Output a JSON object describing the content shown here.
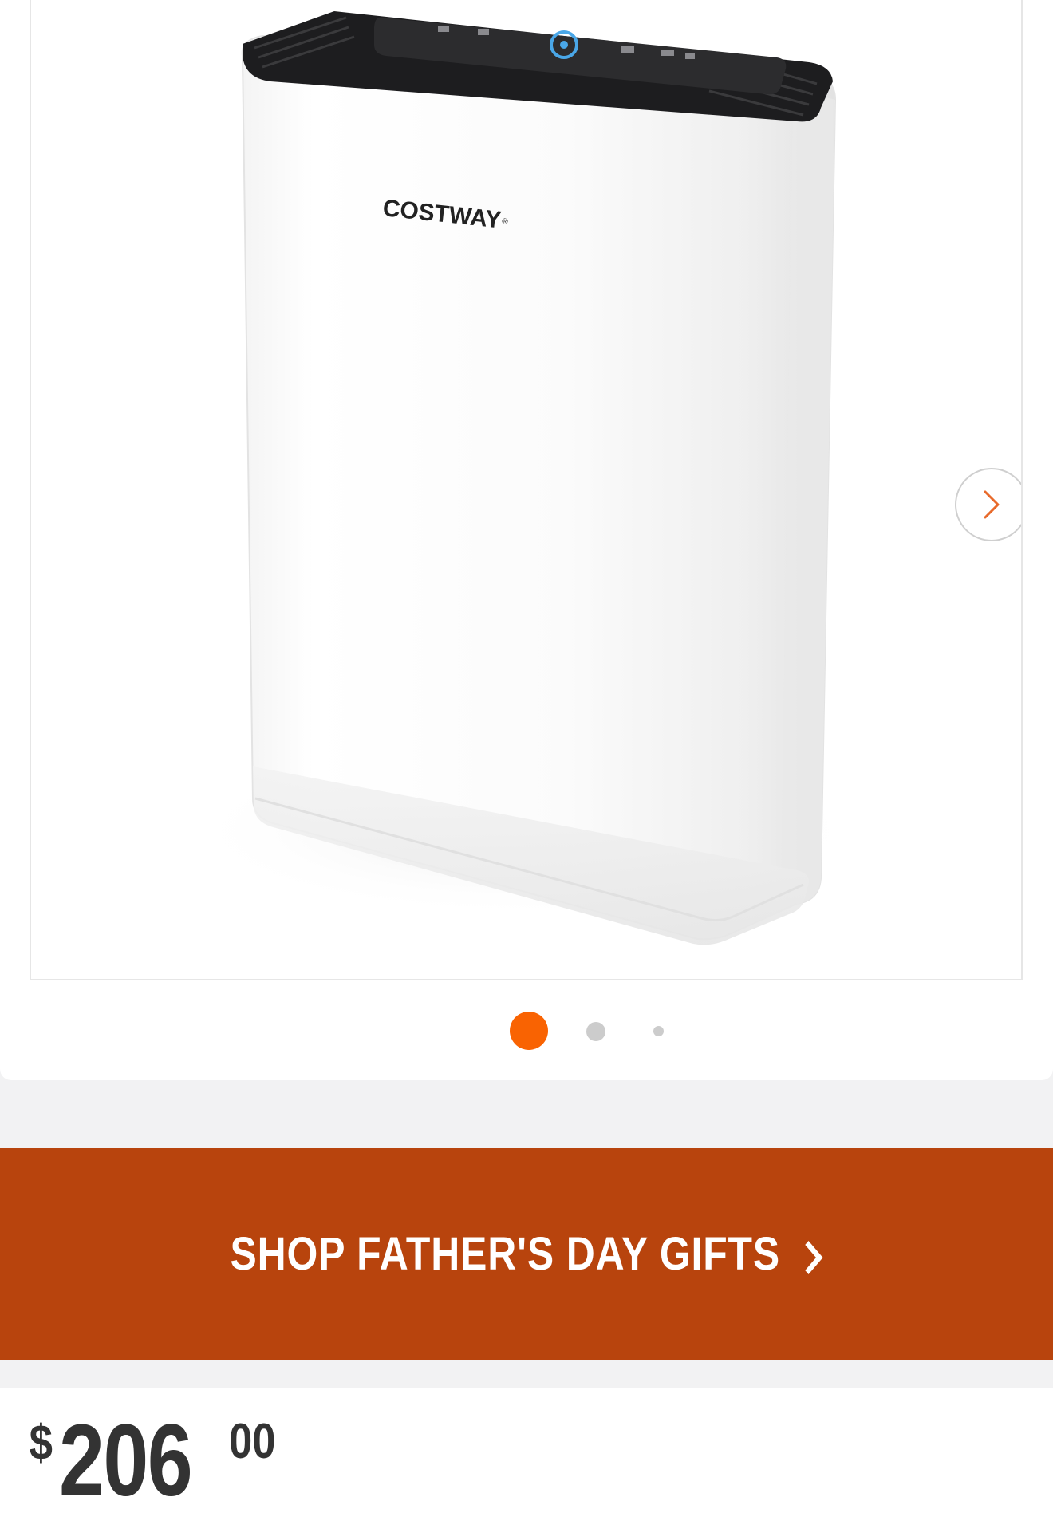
{
  "gallery": {
    "brand_logo_text": "COSTWAY",
    "image_count": 3,
    "active_index": 0,
    "next_icon": "chevron-right-icon",
    "colors": {
      "active_dot": "#f96302",
      "inactive_dot": "#cccccc",
      "next_chevron": "#e86a2b"
    }
  },
  "promo": {
    "label": "SHOP FATHER'S DAY GIFTS",
    "chevron_icon": "chevron-right-icon",
    "background": "#b8440d"
  },
  "price": {
    "currency": "$",
    "dollars": "206",
    "cents": "00"
  }
}
